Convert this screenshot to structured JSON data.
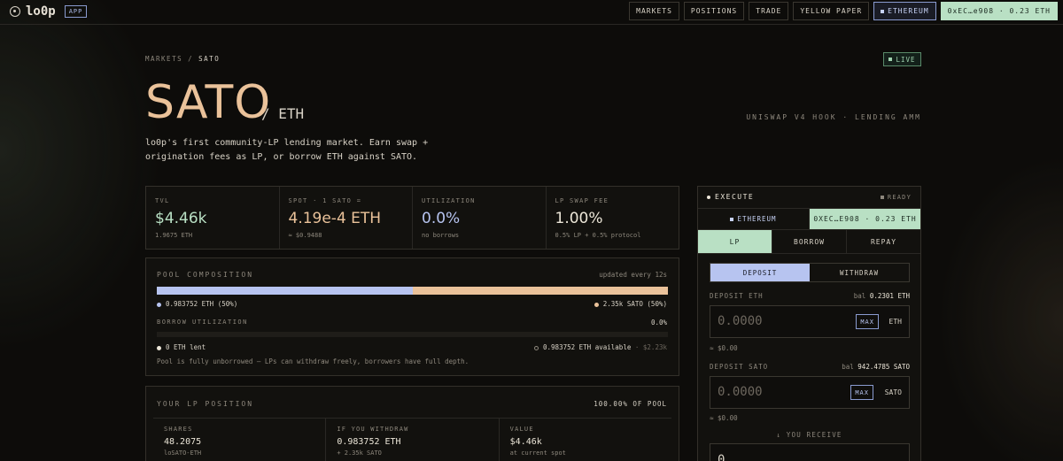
{
  "app": {
    "logo": "lo0p",
    "badge": "APP"
  },
  "nav": {
    "items": [
      "MARKETS",
      "POSITIONS",
      "TRADE",
      "YELLOW PAPER"
    ],
    "network": "ETHEREUM",
    "wallet": "0xEC…e908 · 0.23 ETH"
  },
  "header": {
    "breadcrumb_root": "MARKETS",
    "breadcrumb_sep": "/",
    "breadcrumb_current": "SATO",
    "live": "LIVE",
    "title": "SATO",
    "pair": "/ ETH",
    "hook": "UNISWAP V4 HOOK · LENDING AMM",
    "description": "lo0p's first community-LP lending market. Earn swap + origination fees as LP, or borrow ETH against SATO."
  },
  "stats": [
    {
      "label": "TVL",
      "value": "$4.46k",
      "sub": "1.9675 ETH",
      "color": "green"
    },
    {
      "label": "SPOT · 1 SATO =",
      "value": "4.19e-4 ETH",
      "sub": "≈ $0.9488",
      "color": "peach"
    },
    {
      "label": "UTILIZATION",
      "value": "0.0%",
      "sub": "no borrows",
      "color": "blue"
    },
    {
      "label": "LP SWAP FEE",
      "value": "1.00%",
      "sub": "0.5% LP + 0.5% protocol",
      "color": "cream"
    }
  ],
  "pool": {
    "title": "POOL COMPOSITION",
    "updated": "updated every 12s",
    "eth_share": 0.5,
    "eth_label": "0.983752 ETH (50%)",
    "sato_label": "2.35k SATO (50%)",
    "borrow_label": "BORROW UTILIZATION",
    "borrow_pct": "0.0%",
    "borrow_fraction": 0,
    "lent": "0 ETH lent",
    "available": "0.983752 ETH available",
    "available_usd": "· $2.23k",
    "note": "Pool is fully unborrowed — LPs can withdraw freely, borrowers have full depth."
  },
  "lp": {
    "title": "YOUR LP POSITION",
    "pct": "100.00% OF POOL",
    "cells": [
      {
        "label": "SHARES",
        "value": "48.2075",
        "sub": "loSATO-ETH"
      },
      {
        "label": "IF YOU WITHDRAW",
        "value": "0.983752 ETH",
        "sub": "+ 2.35k SATO"
      },
      {
        "label": "VALUE",
        "value": "$4.46k",
        "sub": "at current spot"
      }
    ]
  },
  "panel": {
    "title": "EXECUTE",
    "status": "READY",
    "network": "ETHEREUM",
    "wallet": "0XEC…E908 · 0.23 ETH",
    "modes": [
      "LP",
      "BORROW",
      "REPAY"
    ],
    "subtabs": [
      "DEPOSIT",
      "WITHDRAW"
    ],
    "eth_field": {
      "label": "DEPOSIT ETH",
      "bal_prefix": "bal",
      "bal": "0.2301 ETH",
      "placeholder": "0.0000",
      "max": "MAX",
      "token": "ETH",
      "usd": "≈ $0.00"
    },
    "sato_field": {
      "label": "DEPOSIT SATO",
      "bal_prefix": "bal",
      "bal": "942.4785 SATO",
      "placeholder": "0.0000",
      "max": "MAX",
      "token": "SATO",
      "usd": "≈ $0.00"
    },
    "receive": "↓ YOU RECEIVE",
    "receive_value": "0"
  },
  "colors": {
    "green": "#b9e0c4",
    "peach": "#eac29a",
    "blue": "#b7c4f0",
    "cream": "#ece6d8"
  }
}
